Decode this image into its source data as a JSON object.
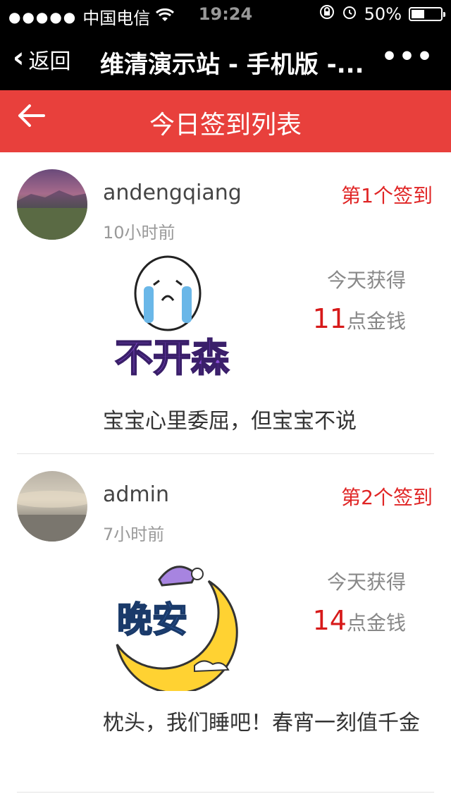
{
  "status_bar": {
    "signal": "●●●●●",
    "carrier": "中国电信",
    "time": "19:24",
    "battery_percent": "50%",
    "battery_level": 0.5
  },
  "wechat_bar": {
    "back_label": "返回",
    "title": "维清演示站 - 手机版 -...",
    "more_label": "•••"
  },
  "header": {
    "title": "今日签到列表"
  },
  "checkins": [
    {
      "username": "andengqiang",
      "time": "10小时前",
      "rank": "第1个签到",
      "today_label": "今天获得",
      "amount": "11",
      "unit": "点金钱",
      "message": "宝宝心里委屈，但宝宝不说",
      "sticker_text": "不开森"
    },
    {
      "username": "admin",
      "time": "7小时前",
      "rank": "第2个签到",
      "today_label": "今天获得",
      "amount": "14",
      "unit": "点金钱",
      "message": "枕头，我们睡吧！春宵一刻值千金",
      "sticker_text": "晚安"
    }
  ],
  "colors": {
    "accent": "#e8403c",
    "rank": "#e02525",
    "amount": "#d71a1a"
  }
}
